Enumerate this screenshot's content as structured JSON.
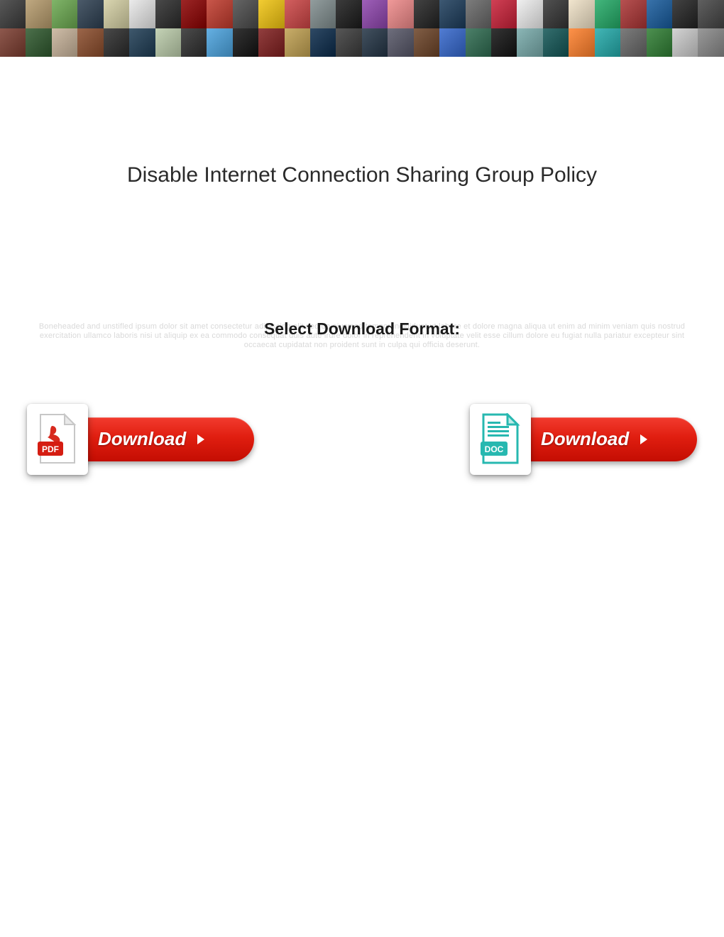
{
  "title": "Disable Internet Connection Sharing Group Policy",
  "subtitle": "Select Download Format:",
  "faded_text": "Boneheaded and unstifled ipsum dolor sit amet consectetur adipiscing elit sed do eiusmod tempor incididunt ut labore et dolore magna aliqua ut enim ad minim veniam quis nostrud exercitation ullamco laboris nisi ut aliquip ex ea commodo consequat duis aute irure dolor in reprehenderit in voluptate velit esse cillum dolore eu fugiat nulla pariatur excepteur sint occaecat cupidatat non proident sunt in culpa qui officia deserunt.",
  "downloads": {
    "pdf": {
      "label": "Download",
      "tag": "PDF"
    },
    "doc": {
      "label": "Download",
      "tag": "DOC"
    }
  },
  "banner_colors_row1": [
    "#3a3a3a",
    "#b59a6b",
    "#6aa84f",
    "#2c3e50",
    "#d4cfa3",
    "#e8e8e8",
    "#2a2a2a",
    "#8b0000",
    "#c0392b",
    "#4a4a4a",
    "#f1c40f",
    "#c44",
    "#7f8c8d",
    "#1a1a1a",
    "#8e44ad",
    "#e88",
    "#222",
    "#1b3b5a",
    "#666",
    "#c91f37",
    "#eee",
    "#333",
    "#efe1c6",
    "#2a6",
    "#a33",
    "#165a9c",
    "#222",
    "#444"
  ],
  "banner_colors_row2": [
    "#7a3b2e",
    "#2d572c",
    "#c7b299",
    "#8a4b2a",
    "#2a2a2a",
    "#1d3b53",
    "#bca",
    "#2d2d2d",
    "#4aa3df",
    "#111",
    "#7f1d1d",
    "#c0a050",
    "#0a2a4a",
    "#3a3a3a",
    "#223344",
    "#556",
    "#6b4226",
    "#36c",
    "#2d6a4f",
    "#111",
    "#7aa",
    "#155",
    "#ff7f2a",
    "#2aa",
    "#666",
    "#2e7d32",
    "#ccc",
    "#888"
  ]
}
